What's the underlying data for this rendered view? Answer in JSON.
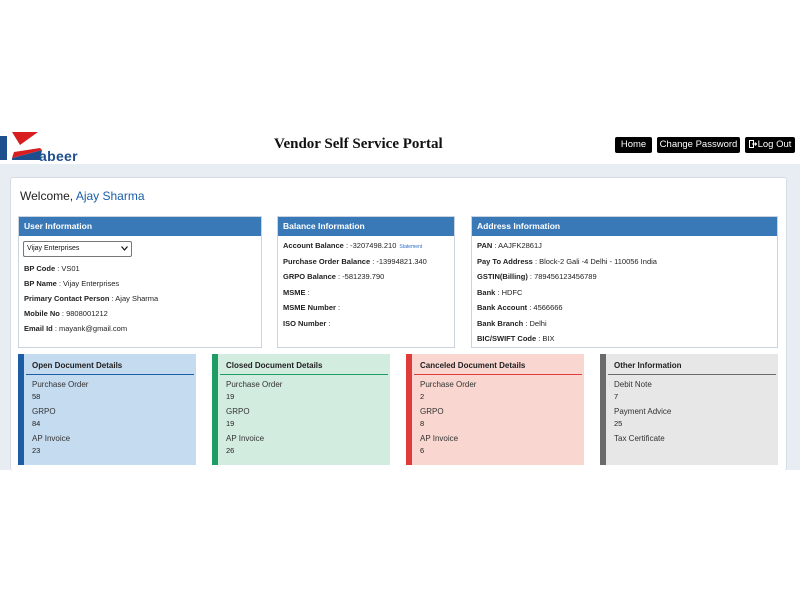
{
  "header": {
    "logo_text": "abeer",
    "title": "Vendor Self Service Portal",
    "nav": {
      "home": "Home",
      "change_password": "Change Password",
      "logout": "Log Out"
    }
  },
  "welcome": {
    "prefix": "Welcome, ",
    "name": "Ajay Sharma"
  },
  "user_info": {
    "title": "User Information",
    "select_value": "Vijay Enterprises",
    "rows": [
      {
        "label": "BP Code",
        "value": " : VS01"
      },
      {
        "label": "BP Name",
        "value": " : Vijay Enterprises"
      },
      {
        "label": "Primary Contact Person",
        "value": " : Ajay Sharma"
      },
      {
        "label": "Mobile No",
        "value": " : 9808001212"
      },
      {
        "label": "Email Id",
        "value": " : mayank@gmail.com"
      }
    ]
  },
  "balance_info": {
    "title": "Balance Information",
    "statement_link": "Statement",
    "rows": [
      {
        "label": "Account Balance",
        "value": " : -3207498.210"
      },
      {
        "label": "Purchase Order Balance",
        "value": " : -13994821.340"
      },
      {
        "label": "GRPO Balance",
        "value": " : -581239.790"
      },
      {
        "label": "MSME",
        "value": " :"
      },
      {
        "label": "MSME Number",
        "value": " :"
      },
      {
        "label": "ISO Number",
        "value": " :"
      }
    ]
  },
  "address_info": {
    "title": "Address Information",
    "rows": [
      {
        "label": "PAN",
        "value": " : AAJFK2861J"
      },
      {
        "label": "Pay To Address",
        "value": " : Block-2 Gali -4 Delhi - 110056 India"
      },
      {
        "label": "GSTIN(Billing)",
        "value": " : 789456123456789"
      },
      {
        "label": "Bank",
        "value": " : HDFC"
      },
      {
        "label": "Bank Account",
        "value": " : 4566666"
      },
      {
        "label": "Bank Branch",
        "value": " : Delhi"
      },
      {
        "label": "BIC/SWIFT Code",
        "value": " : BIX"
      }
    ]
  },
  "documents": {
    "open": {
      "title": "Open Document Details",
      "items": [
        {
          "label": "Purchase Order",
          "value": "58"
        },
        {
          "label": "GRPO",
          "value": "84"
        },
        {
          "label": "AP Invoice",
          "value": "23"
        }
      ]
    },
    "closed": {
      "title": "Closed Document Details",
      "items": [
        {
          "label": "Purchase Order",
          "value": "19"
        },
        {
          "label": "GRPO",
          "value": "19"
        },
        {
          "label": "AP Invoice",
          "value": "26"
        }
      ]
    },
    "canceled": {
      "title": "Canceled Document Details",
      "items": [
        {
          "label": "Purchase Order",
          "value": "2"
        },
        {
          "label": "GRPO",
          "value": "8"
        },
        {
          "label": "AP Invoice",
          "value": "6"
        }
      ]
    },
    "other": {
      "title": "Other Information",
      "items": [
        {
          "label": "Debit Note",
          "value": "7"
        },
        {
          "label": "Payment Advice",
          "value": "25"
        },
        {
          "label": "Tax Certificate",
          "value": ""
        }
      ]
    }
  },
  "colors": {
    "header_blue": "#3a79b8",
    "open_accent": "#1c5da6",
    "closed_accent": "#1f9c63",
    "canceled_accent": "#e03b3b",
    "other_accent": "#6b6b6b"
  }
}
